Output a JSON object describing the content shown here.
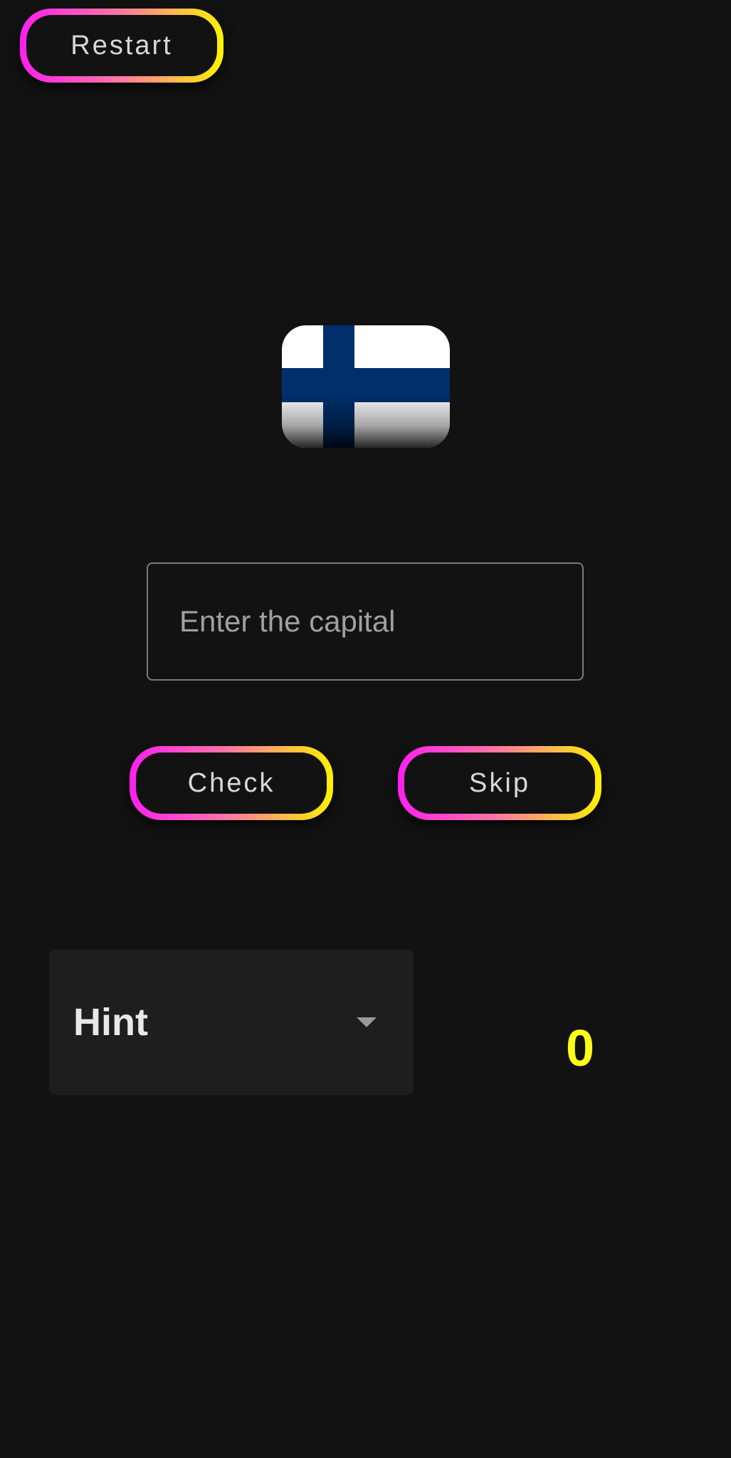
{
  "buttons": {
    "restart_label": "Restart",
    "check_label": "Check",
    "skip_label": "Skip"
  },
  "flag": {
    "icon": "finland-flag-icon",
    "colors": {
      "field": "#ffffff",
      "cross": "#002f6c"
    }
  },
  "input": {
    "placeholder": "Enter the capital",
    "value": ""
  },
  "hint": {
    "selected": "Hint"
  },
  "score": {
    "value": "0"
  },
  "theme": {
    "background": "#121212",
    "gradient_start": "#ff1ff0",
    "gradient_end": "#fff200",
    "score_color": "#ffff1a"
  }
}
